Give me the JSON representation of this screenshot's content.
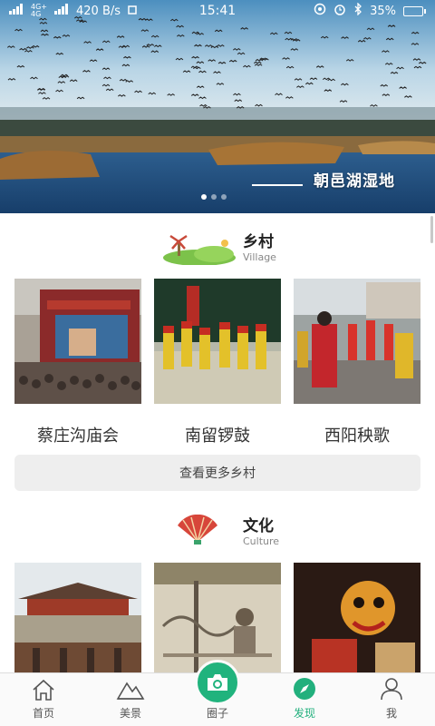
{
  "status_bar": {
    "signal_1": "4G+",
    "signal_2": "4G",
    "speed": "420 B/s",
    "time": "15:41",
    "battery": "35%",
    "battery_level": 0.35
  },
  "banner": {
    "caption": "朝邑湖湿地",
    "slide_index": 1,
    "slide_count": 3
  },
  "village": {
    "title": "乡村",
    "subtitle": "Village",
    "items": [
      {
        "name": "蔡庄沟庙会"
      },
      {
        "name": "南留锣鼓"
      },
      {
        "name": "西阳秧歌"
      }
    ],
    "more_label": "查看更多乡村"
  },
  "culture": {
    "title": "文化",
    "subtitle": "Culture"
  },
  "tab_bar": {
    "items": [
      {
        "label": "首页",
        "icon": "home-icon"
      },
      {
        "label": "美景",
        "icon": "mountain-icon"
      },
      {
        "label": "圈子",
        "icon": "camera-icon"
      },
      {
        "label": "发现",
        "icon": "compass-icon",
        "active": true
      },
      {
        "label": "我",
        "icon": "person-icon"
      }
    ]
  },
  "colors": {
    "accent": "#22b07d",
    "camera": "#20b37d"
  }
}
